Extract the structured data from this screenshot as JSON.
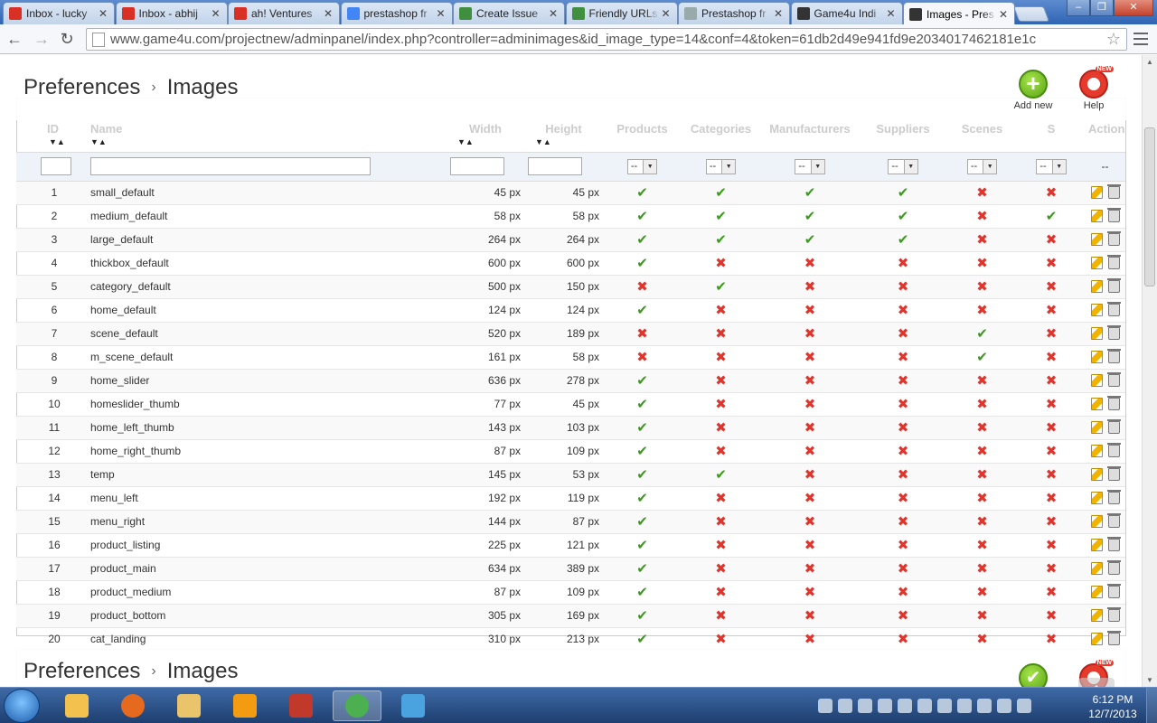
{
  "browser": {
    "tabs": [
      {
        "title": "Inbox - lucky",
        "favicon": "gmail-icon",
        "active": false
      },
      {
        "title": "Inbox - abhij",
        "favicon": "gmail-icon",
        "active": false
      },
      {
        "title": "ah! Ventures",
        "favicon": "gmail-icon",
        "active": false
      },
      {
        "title": "prestashop fr",
        "favicon": "google-icon",
        "active": false
      },
      {
        "title": "Create Issue",
        "favicon": "bitbucket-icon",
        "active": false
      },
      {
        "title": "Friendly URLs",
        "favicon": "bitbucket-icon",
        "active": false
      },
      {
        "title": "Prestashop fr",
        "favicon": "page-icon",
        "active": false
      },
      {
        "title": "Game4u Indi",
        "favicon": "prestashop-icon",
        "active": false
      },
      {
        "title": "Images - Pres",
        "favicon": "prestashop-icon",
        "active": true
      }
    ],
    "url": "www.game4u.com/projectnew/adminpanel/index.php?controller=adminimages&id_image_type=14&conf=4&token=61db2d49e941fd9e2034017462181e1c"
  },
  "page": {
    "breadcrumb": {
      "parent": "Preferences",
      "current": "Images"
    },
    "breadcrumb_repeat": {
      "parent": "Preferences",
      "current": "Images"
    },
    "add_new_label": "Add new",
    "help_label": "Help",
    "columns": [
      "ID",
      "Name",
      "Width",
      "Height",
      "Products",
      "Categories",
      "Manufacturers",
      "Suppliers",
      "Scenes",
      "S",
      "Actions"
    ],
    "filter_select_value": "--",
    "actions_filter_value": "--",
    "rows": [
      {
        "id": "1",
        "name": "small_default",
        "width": "45 px",
        "height": "45 px",
        "flags": [
          1,
          1,
          1,
          1,
          0,
          0
        ]
      },
      {
        "id": "2",
        "name": "medium_default",
        "width": "58 px",
        "height": "58 px",
        "flags": [
          1,
          1,
          1,
          1,
          0,
          1
        ]
      },
      {
        "id": "3",
        "name": "large_default",
        "width": "264 px",
        "height": "264 px",
        "flags": [
          1,
          1,
          1,
          1,
          0,
          0
        ]
      },
      {
        "id": "4",
        "name": "thickbox_default",
        "width": "600 px",
        "height": "600 px",
        "flags": [
          1,
          0,
          0,
          0,
          0,
          0
        ]
      },
      {
        "id": "5",
        "name": "category_default",
        "width": "500 px",
        "height": "150 px",
        "flags": [
          0,
          1,
          0,
          0,
          0,
          0
        ]
      },
      {
        "id": "6",
        "name": "home_default",
        "width": "124 px",
        "height": "124 px",
        "flags": [
          1,
          0,
          0,
          0,
          0,
          0
        ]
      },
      {
        "id": "7",
        "name": "scene_default",
        "width": "520 px",
        "height": "189 px",
        "flags": [
          0,
          0,
          0,
          0,
          1,
          0
        ]
      },
      {
        "id": "8",
        "name": "m_scene_default",
        "width": "161 px",
        "height": "58 px",
        "flags": [
          0,
          0,
          0,
          0,
          1,
          0
        ]
      },
      {
        "id": "9",
        "name": "home_slider",
        "width": "636 px",
        "height": "278 px",
        "flags": [
          1,
          0,
          0,
          0,
          0,
          0
        ]
      },
      {
        "id": "10",
        "name": "homeslider_thumb",
        "width": "77 px",
        "height": "45 px",
        "flags": [
          1,
          0,
          0,
          0,
          0,
          0
        ]
      },
      {
        "id": "11",
        "name": "home_left_thumb",
        "width": "143 px",
        "height": "103 px",
        "flags": [
          1,
          0,
          0,
          0,
          0,
          0
        ]
      },
      {
        "id": "12",
        "name": "home_right_thumb",
        "width": "87 px",
        "height": "109 px",
        "flags": [
          1,
          0,
          0,
          0,
          0,
          0
        ]
      },
      {
        "id": "13",
        "name": "temp",
        "width": "145 px",
        "height": "53 px",
        "flags": [
          1,
          1,
          0,
          0,
          0,
          0
        ]
      },
      {
        "id": "14",
        "name": "menu_left",
        "width": "192 px",
        "height": "119 px",
        "flags": [
          1,
          0,
          0,
          0,
          0,
          0
        ]
      },
      {
        "id": "15",
        "name": "menu_right",
        "width": "144 px",
        "height": "87 px",
        "flags": [
          1,
          0,
          0,
          0,
          0,
          0
        ]
      },
      {
        "id": "16",
        "name": "product_listing",
        "width": "225 px",
        "height": "121 px",
        "flags": [
          1,
          0,
          0,
          0,
          0,
          0
        ]
      },
      {
        "id": "17",
        "name": "product_main",
        "width": "634 px",
        "height": "389 px",
        "flags": [
          1,
          0,
          0,
          0,
          0,
          0
        ]
      },
      {
        "id": "18",
        "name": "product_medium",
        "width": "87 px",
        "height": "109 px",
        "flags": [
          1,
          0,
          0,
          0,
          0,
          0
        ]
      },
      {
        "id": "19",
        "name": "product_bottom",
        "width": "305 px",
        "height": "169 px",
        "flags": [
          1,
          0,
          0,
          0,
          0,
          0
        ]
      },
      {
        "id": "20",
        "name": "cat_landing",
        "width": "310 px",
        "height": "213 px",
        "flags": [
          1,
          0,
          0,
          0,
          0,
          0
        ]
      }
    ]
  },
  "taskbar": {
    "apps": [
      "outlook-icon",
      "firefox-icon",
      "explorer-icon",
      "media-player-icon",
      "filezilla-icon",
      "chrome-icon",
      "google-talk-icon"
    ],
    "clock_time": "6:12 PM",
    "clock_date": "12/7/2013"
  },
  "colors": {
    "ok": "#3a9a1a",
    "no": "#e0342c",
    "tabbar": "#2e64b2"
  }
}
